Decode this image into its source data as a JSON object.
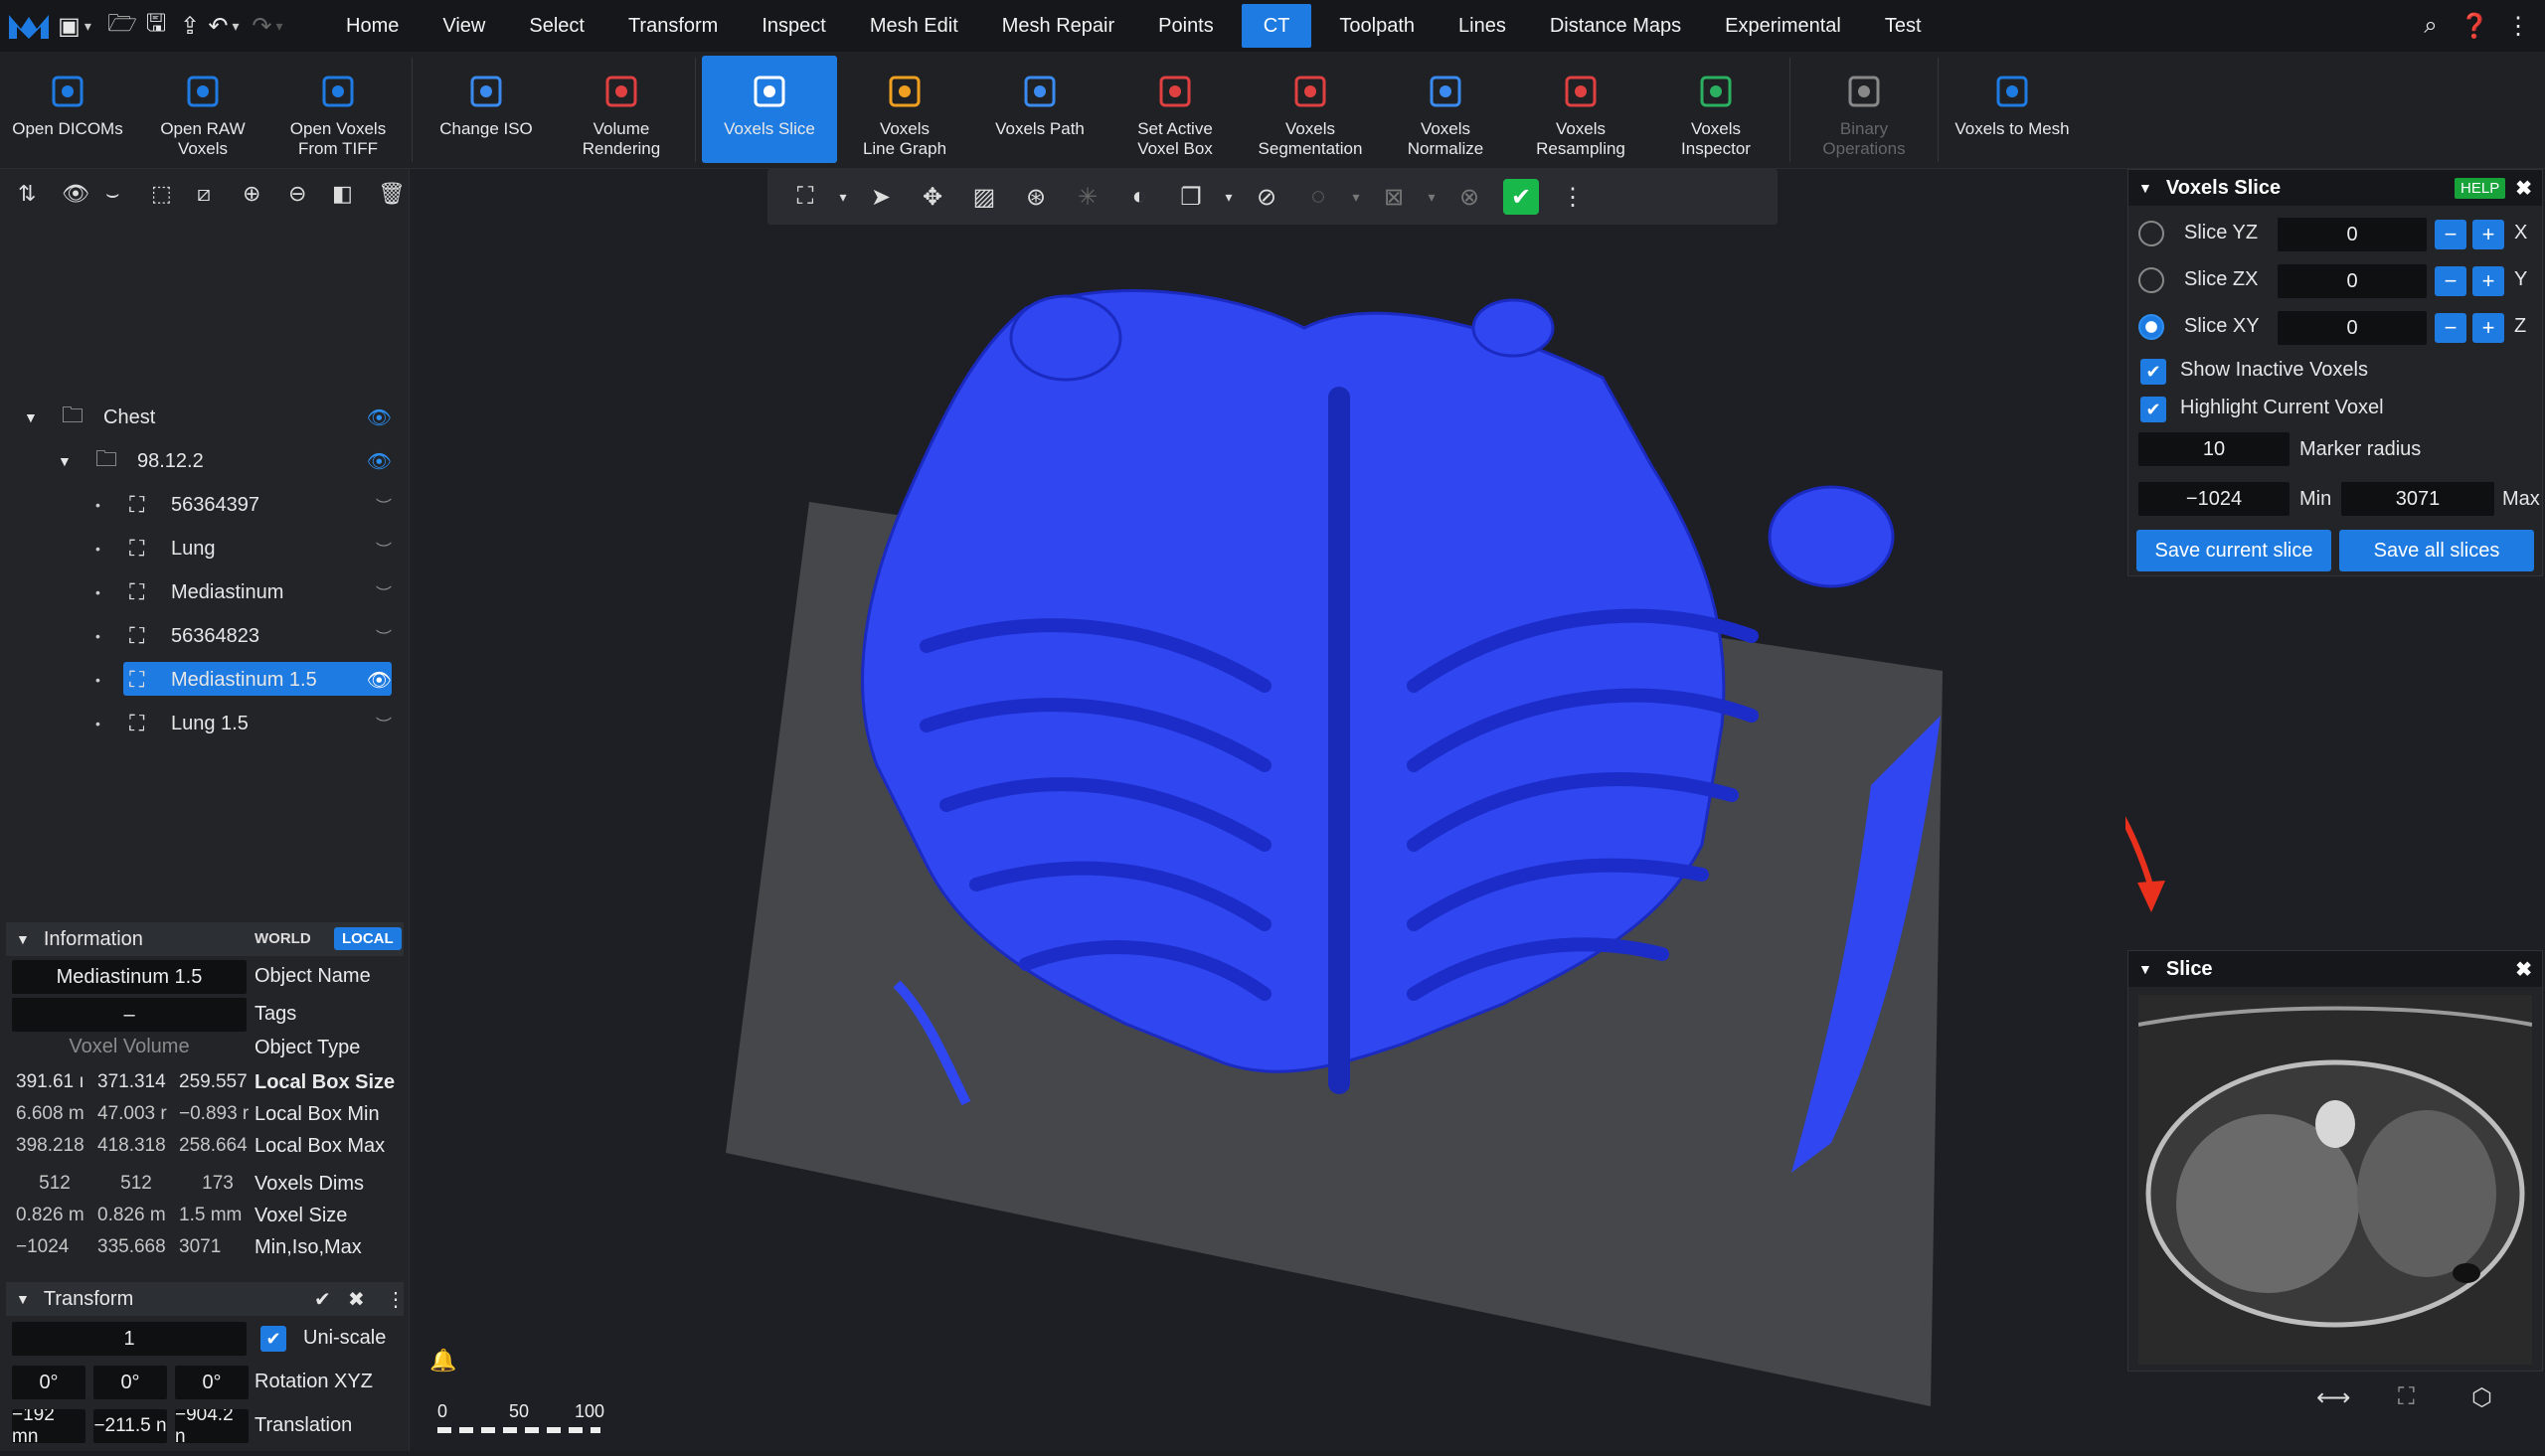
{
  "menubar": {
    "items": [
      "Home",
      "View",
      "Select",
      "Transform",
      "Inspect",
      "Mesh Edit",
      "Mesh Repair",
      "Points",
      "CT",
      "Toolpath",
      "Lines",
      "Distance Maps",
      "Experimental",
      "Test"
    ],
    "active": "CT"
  },
  "ribbon": {
    "buttons": [
      {
        "label": "Open DICOMs",
        "icon": "open-dicoms-icon"
      },
      {
        "label": "Open RAW\nVoxels",
        "icon": "open-raw-voxels-icon"
      },
      {
        "label": "Open Voxels\nFrom TIFF",
        "icon": "open-tiff-icon"
      },
      {
        "label": "Change ISO",
        "icon": "change-iso-icon"
      },
      {
        "label": "Volume\nRendering",
        "icon": "volume-rendering-icon"
      },
      {
        "label": "Voxels Slice",
        "icon": "voxels-slice-icon"
      },
      {
        "label": "Voxels\nLine Graph",
        "icon": "line-graph-icon"
      },
      {
        "label": "Voxels Path",
        "icon": "voxels-path-icon"
      },
      {
        "label": "Set Active\nVoxel Box",
        "icon": "voxel-box-icon"
      },
      {
        "label": "Voxels\nSegmentation",
        "icon": "segmentation-icon"
      },
      {
        "label": "Voxels\nNormalize",
        "icon": "normalize-icon"
      },
      {
        "label": "Voxels\nResampling",
        "icon": "resampling-icon"
      },
      {
        "label": "Voxels\nInspector",
        "icon": "inspector-icon"
      },
      {
        "label": "Binary\nOperations",
        "icon": "binary-operations-icon"
      },
      {
        "label": "Voxels to Mesh",
        "icon": "voxels-to-mesh-icon"
      }
    ]
  },
  "tree": {
    "root": "Chest",
    "group": "98.12.2",
    "items": [
      "56364397",
      "Lung",
      "Mediastinum",
      "56364823",
      "Mediastinum 1.5",
      "Lung 1.5"
    ],
    "selected": "Mediastinum 1.5"
  },
  "info": {
    "title": "Information",
    "world": "WORLD",
    "local": "LOCAL",
    "object_name_value": "Mediastinum 1.5",
    "object_name_label": "Object Name",
    "tags_value": "–",
    "tags_label": "Tags",
    "type_value": "Voxel Volume",
    "type_label": "Object Type",
    "rows": [
      {
        "v": [
          "391.61 ı",
          "371.314",
          "259.557"
        ],
        "label": "Local Box Size",
        "bold": true
      },
      {
        "v": [
          "6.608 m",
          "47.003 r",
          "−0.893 r"
        ],
        "label": "Local Box Min",
        "bold": false
      },
      {
        "v": [
          "398.218",
          "418.318",
          "258.664"
        ],
        "label": "Local Box Max",
        "bold": false
      },
      {
        "v": [
          "512",
          "512",
          "173"
        ],
        "label": "Voxels Dims",
        "bold": false
      },
      {
        "v": [
          "0.826 m",
          "0.826 m",
          "1.5 mm"
        ],
        "label": "Voxel Size",
        "bold": false
      },
      {
        "v": [
          "−1024",
          "335.668",
          "3071"
        ],
        "label": "Min,Iso,Max",
        "bold": false
      }
    ]
  },
  "transform": {
    "title": "Transform",
    "scale_value": "1",
    "uniscale_label": "Uni-scale",
    "rotation": [
      "0°",
      "0°",
      "0°"
    ],
    "rotation_label": "Rotation XYZ",
    "translation": [
      "−192 mn",
      "−211.5 n",
      "−904.2 n"
    ],
    "translation_label": "Translation"
  },
  "voxels_slice": {
    "title": "Voxels Slice",
    "help": "HELP",
    "slices": [
      {
        "label": "Slice YZ",
        "value": "0",
        "axis": "X",
        "selected": false
      },
      {
        "label": "Slice ZX",
        "value": "0",
        "axis": "Y",
        "selected": false
      },
      {
        "label": "Slice XY",
        "value": "0",
        "axis": "Z",
        "selected": true
      }
    ],
    "show_inactive": "Show Inactive Voxels",
    "highlight_current": "Highlight Current Voxel",
    "marker_radius_value": "10",
    "marker_radius_label": "Marker radius",
    "min_value": "−1024",
    "min_label": "Min",
    "max_value": "3071",
    "max_label": "Max",
    "save_current": "Save current slice",
    "save_all": "Save all slices"
  },
  "slice_panel": {
    "title": "Slice"
  },
  "ruler": {
    "labels": [
      "0",
      "50",
      "100"
    ]
  },
  "colors": {
    "accent": "#1e7be2",
    "bone": "#2f46f0",
    "arrow": "#e8301c"
  }
}
